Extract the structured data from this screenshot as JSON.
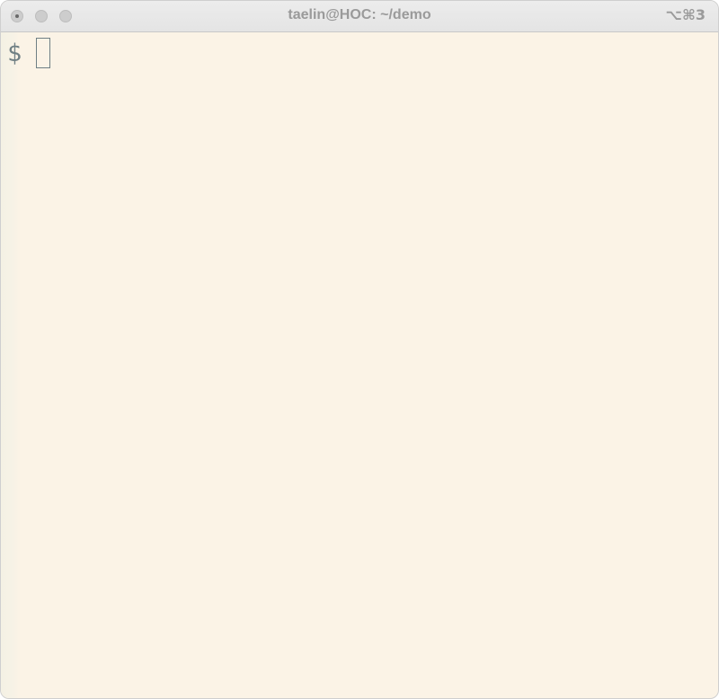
{
  "window": {
    "title": "taelin@HOC: ~/demo",
    "shortcut": "⌥⌘3"
  },
  "terminal": {
    "prompt": "$"
  },
  "colors": {
    "background": "#fbf3e6",
    "titlebar": "#e8e8e8",
    "text": "#6f7f84"
  },
  "icons": {
    "close": "close-button",
    "minimize": "minimize-button",
    "zoom": "zoom-button"
  }
}
